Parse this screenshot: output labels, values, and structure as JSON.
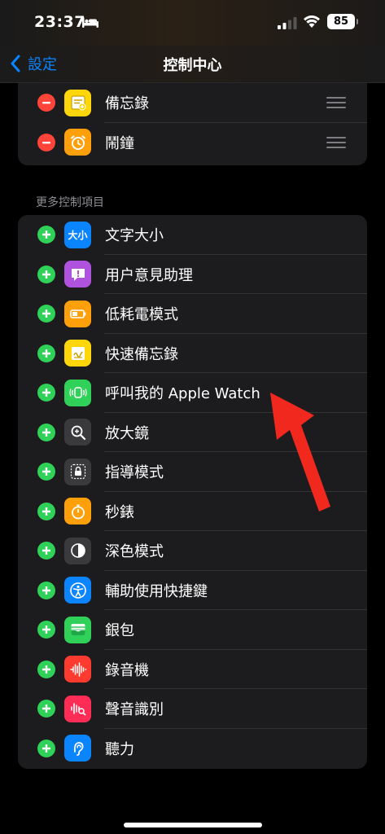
{
  "status_bar": {
    "time": "23:37",
    "battery": "85"
  },
  "nav": {
    "back_label": "設定",
    "title": "控制中心"
  },
  "included_controls": [
    {
      "label": "備忘錄",
      "icon": "notes-icon",
      "color": "#FFD60A"
    },
    {
      "label": "鬧鐘",
      "icon": "alarm-icon",
      "color": "#FF9F0A"
    }
  ],
  "more_section": {
    "header": "更多控制項目",
    "items": [
      {
        "label": "文字大小",
        "icon": "text-size-icon",
        "color": "#0A84FF",
        "glyph": "大小"
      },
      {
        "label": "用户意見助理",
        "icon": "feedback-icon",
        "color": "#AF52DE"
      },
      {
        "label": "低耗電模式",
        "icon": "battery-icon",
        "color": "#FF9F0A"
      },
      {
        "label": "快速備忘錄",
        "icon": "quick-note-icon",
        "color": "#FFD60A"
      },
      {
        "label": "呼叫我的 Apple Watch",
        "icon": "ping-watch-icon",
        "color": "#30D158"
      },
      {
        "label": "放大鏡",
        "icon": "magnifier-icon",
        "color": "#3A3A3C"
      },
      {
        "label": "指導模式",
        "icon": "guided-access-icon",
        "color": "#3A3A3C"
      },
      {
        "label": "秒錶",
        "icon": "stopwatch-icon",
        "color": "#FF9F0A"
      },
      {
        "label": "深色模式",
        "icon": "dark-mode-icon",
        "color": "#3A3A3C"
      },
      {
        "label": "輔助使用快捷鍵",
        "icon": "accessibility-icon",
        "color": "#0A84FF"
      },
      {
        "label": "銀包",
        "icon": "wallet-icon",
        "color": "#30D158"
      },
      {
        "label": "錄音機",
        "icon": "voice-memo-icon",
        "color": "#FF3B30"
      },
      {
        "label": "聲音識別",
        "icon": "sound-recognition-icon",
        "color": "#FF2D55"
      },
      {
        "label": "聽力",
        "icon": "hearing-icon",
        "color": "#0A84FF"
      }
    ]
  },
  "annotation": {
    "arrow_color": "#F0281E"
  }
}
